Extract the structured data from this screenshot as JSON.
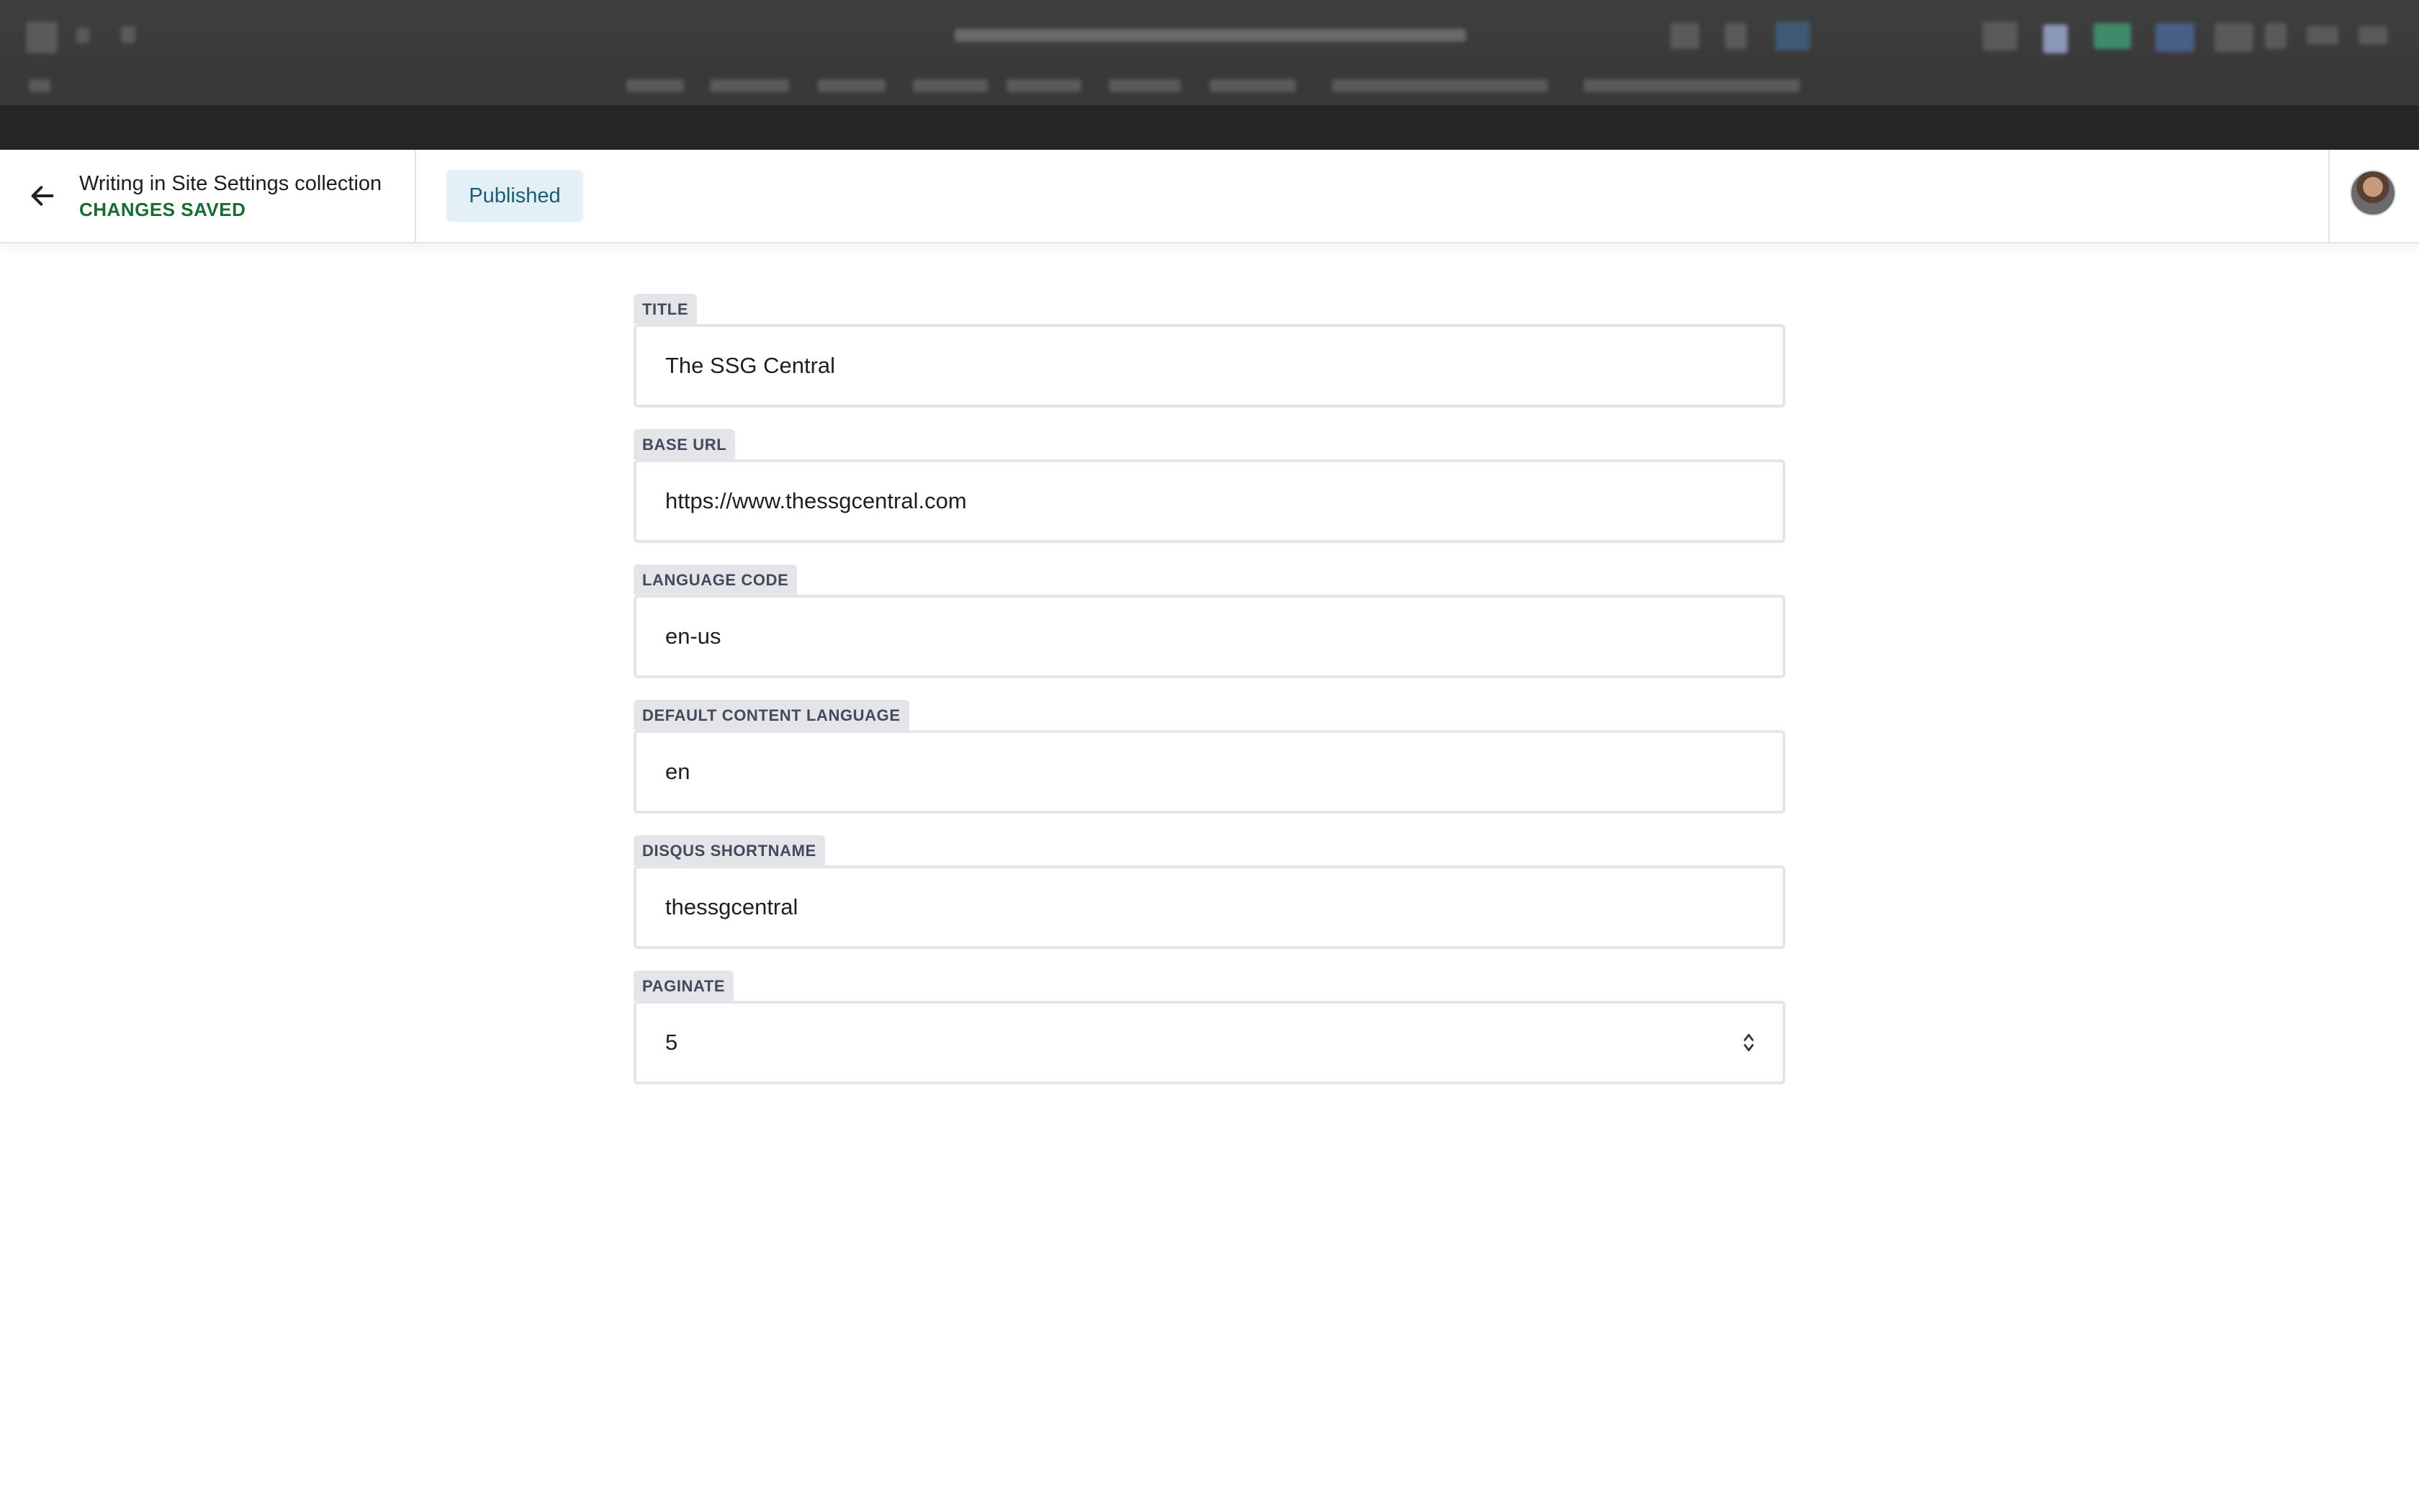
{
  "header": {
    "title": "Writing in Site Settings collection",
    "status": "CHANGES SAVED",
    "publish_state": "Published"
  },
  "icons": {
    "back": "arrow-left-icon",
    "stepper": "chevron-updown-icon",
    "avatar": "user-avatar"
  },
  "colors": {
    "status_green": "#1b6b34",
    "pill_background": "#e3f1f6",
    "pill_text": "#1c5a76",
    "label_background": "#e4e5e9",
    "label_text": "#45495a"
  },
  "fields": [
    {
      "label": "TITLE",
      "value": "The SSG Central"
    },
    {
      "label": "BASE URL",
      "value": "https://www.thessgcentral.com"
    },
    {
      "label": "LANGUAGE CODE",
      "value": "en-us"
    },
    {
      "label": "DEFAULT CONTENT LANGUAGE",
      "value": "en"
    },
    {
      "label": "DISQUS SHORTNAME",
      "value": "thessgcentral"
    },
    {
      "label": "PAGINATE",
      "value": "5"
    }
  ]
}
